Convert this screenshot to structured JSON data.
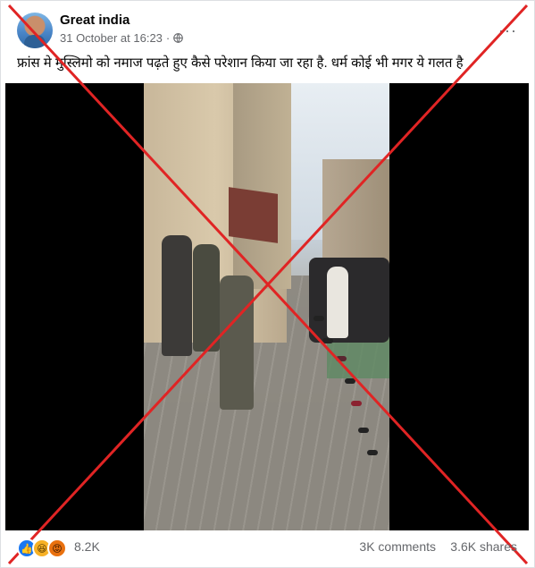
{
  "post": {
    "author": "Great india",
    "timestamp": "31 October at 16:23",
    "separator": "·",
    "more_label": "···",
    "caption": "फ्रांस मे मुस्लिमो को नमाज पढ़ते हुए कैसे परेशान किया जा रहा है. धर्म कोई भी मगर ये गलत है"
  },
  "footer": {
    "reaction_count": "8.2K",
    "comments": "3K comments",
    "shares": "3.6K shares",
    "reactions": [
      "like-icon",
      "haha-icon",
      "angry-icon"
    ]
  },
  "colors": {
    "cross": "#e02424",
    "meta_text": "#65676b",
    "like": "#1877f2"
  }
}
